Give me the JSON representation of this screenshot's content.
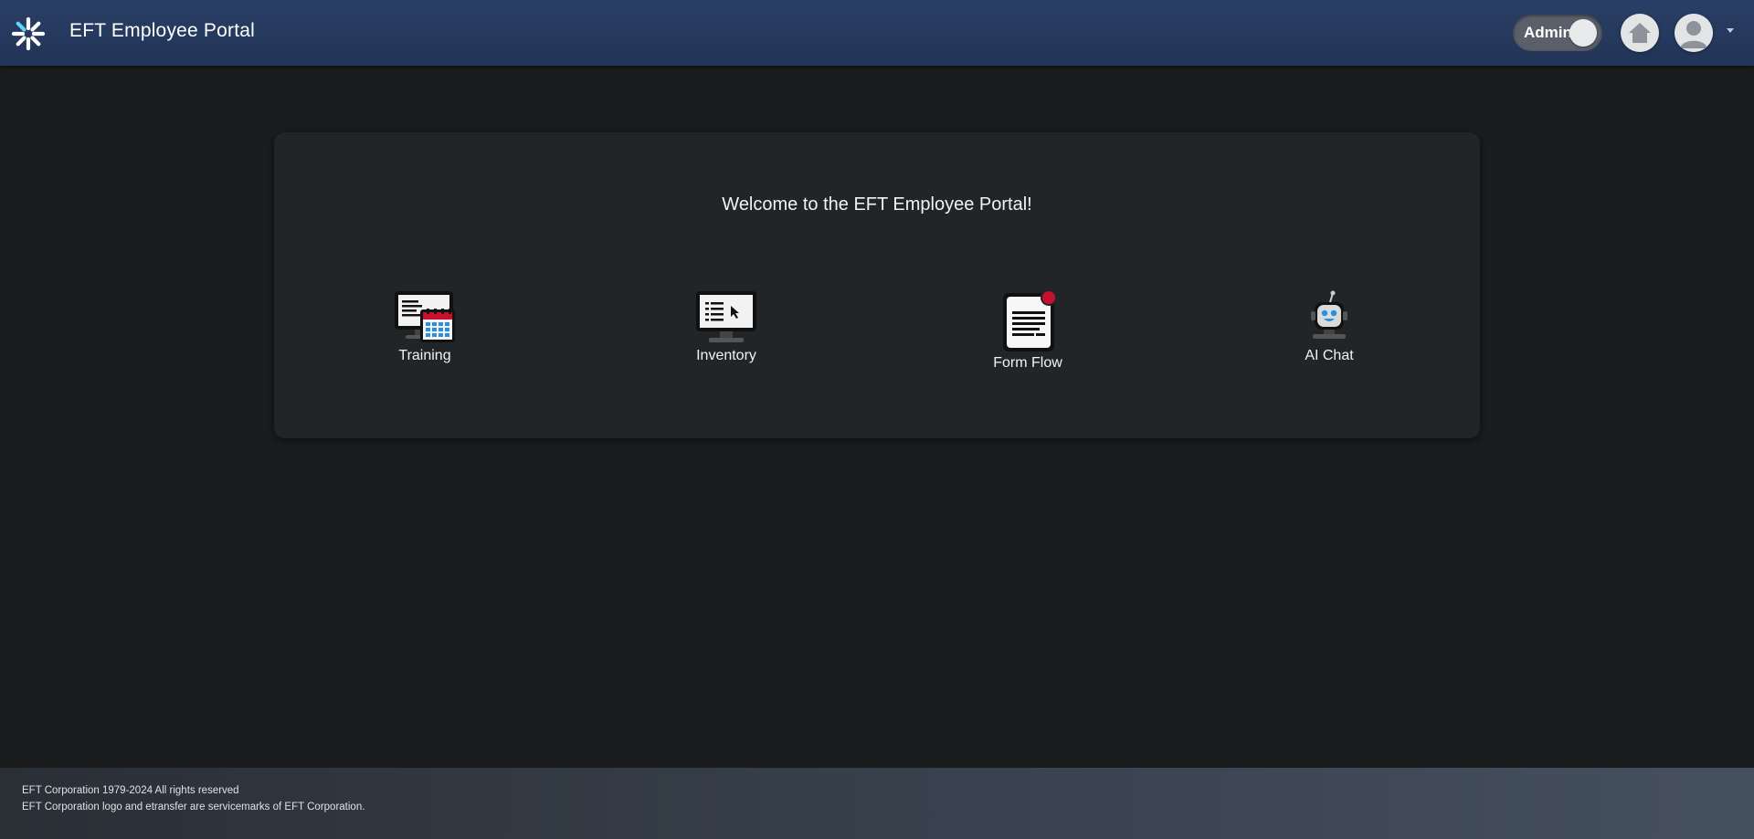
{
  "header": {
    "title": "EFT Employee Portal",
    "admin_toggle_label": "Admin",
    "logo_icon": "snowflake-logo",
    "home_icon": "home-icon",
    "avatar_icon": "user-avatar-icon"
  },
  "main": {
    "welcome": "Welcome to the EFT Employee Portal!",
    "tiles": [
      {
        "label": "Training",
        "icon": "monitor-calendar-icon"
      },
      {
        "label": "Inventory",
        "icon": "monitor-cursor-icon"
      },
      {
        "label": "Form Flow",
        "icon": "document-notification-icon"
      },
      {
        "label": "AI Chat",
        "icon": "robot-icon"
      }
    ]
  },
  "footer": {
    "line1": "EFT Corporation 1979-2024 All rights reserved",
    "line2": "EFT Corporation logo and etransfer are servicemarks of EFT Corporation."
  },
  "colors": {
    "header_bg": "#243759",
    "page_bg": "#1b1c1e",
    "card_bg": "#222528",
    "notification_dot": "#c8102e"
  }
}
